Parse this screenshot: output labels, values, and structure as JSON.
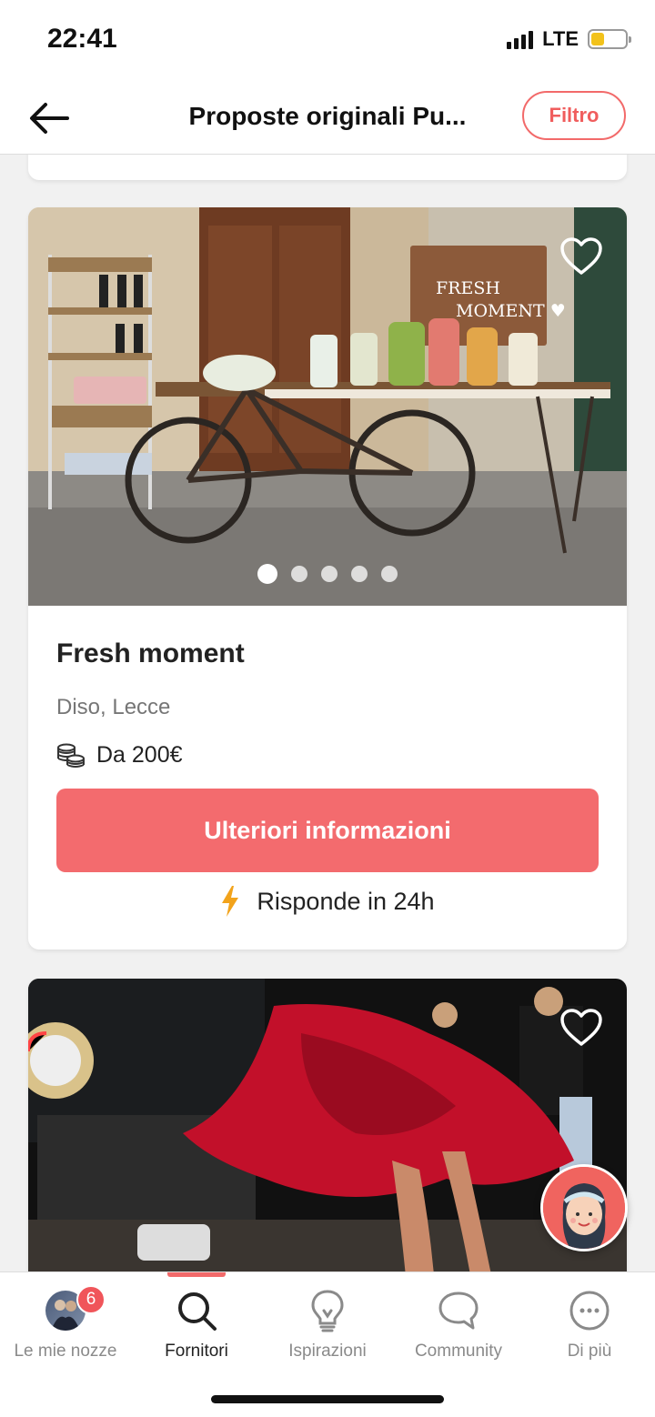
{
  "status_bar": {
    "time": "22:41",
    "network": "LTE",
    "battery_level": 0.4
  },
  "nav": {
    "title": "Proposte originali Pu...",
    "filter_label": "Filtro"
  },
  "cards": [
    {
      "name": "Fresh moment",
      "location": "Diso, Lecce",
      "price": "Da 200€",
      "cta_label": "Ulteriori informazioni",
      "response": "Risponde in 24h",
      "image_sign": [
        "FRESH",
        "MOMENT ♥"
      ],
      "photo_count": 5,
      "active_photo": 1
    }
  ],
  "tabs": [
    {
      "label": "Le mie nozze",
      "icon": "avatar-icon",
      "badge": "6"
    },
    {
      "label": "Fornitori",
      "icon": "search-icon",
      "active": true
    },
    {
      "label": "Ispirazioni",
      "icon": "lightbulb-icon"
    },
    {
      "label": "Community",
      "icon": "chat-bubble-icon"
    },
    {
      "label": "Di più",
      "icon": "more-icon"
    }
  ],
  "colors": {
    "accent": "#f36b6e",
    "bolt": "#f2a31b"
  }
}
